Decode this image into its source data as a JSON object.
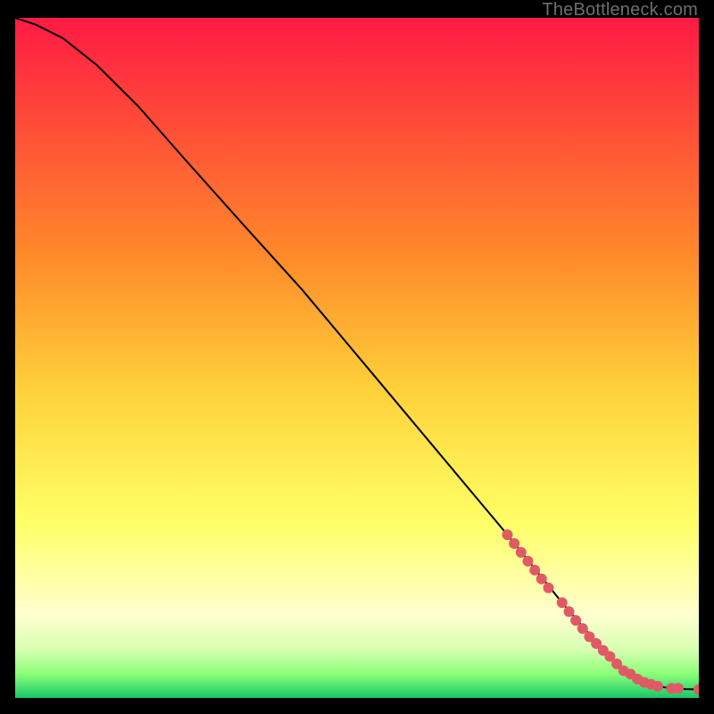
{
  "watermark": "TheBottleneck.com",
  "colors": {
    "curve": "#000000",
    "dot": "#e05a66",
    "border": "#000000",
    "grad_top": "#ff1a44",
    "grad_mid1": "#ff8a2a",
    "grad_mid2": "#ffd23a",
    "grad_mid3": "#ffff66",
    "grad_mid4": "#ffffd0",
    "grad_mid5": "#d6ffb0",
    "grad_mid6": "#8aff78",
    "grad_bot": "#18c76a"
  },
  "chart_data": {
    "type": "line",
    "title": "",
    "xlabel": "",
    "ylabel": "",
    "xlim": [
      0,
      100
    ],
    "ylim": [
      0,
      100
    ],
    "curve": {
      "name": "bottleneck-curve",
      "x": [
        0,
        3,
        7,
        12,
        18,
        25,
        33,
        42,
        52,
        62,
        72,
        80,
        86,
        88,
        90,
        92,
        94,
        96,
        98,
        100
      ],
      "y": [
        100,
        99,
        97,
        93,
        87,
        79,
        70,
        60,
        48,
        36,
        24,
        14,
        7,
        5,
        3.5,
        2.3,
        1.7,
        1.4,
        1.3,
        1.25
      ]
    },
    "series": [
      {
        "name": "highlighted-points",
        "x": [
          72,
          73,
          74,
          75,
          76,
          77,
          78,
          80,
          81,
          82,
          83,
          84,
          85,
          86,
          87,
          88,
          89,
          90,
          91,
          92,
          93,
          94,
          96,
          97,
          100
        ],
        "y": [
          24,
          22.7,
          21.4,
          20.1,
          18.8,
          17.5,
          16.2,
          14,
          12.7,
          11.4,
          10.2,
          9.0,
          8.0,
          7.0,
          6.1,
          5.0,
          4.0,
          3.5,
          2.8,
          2.3,
          2.0,
          1.7,
          1.4,
          1.4,
          1.25
        ]
      }
    ]
  }
}
